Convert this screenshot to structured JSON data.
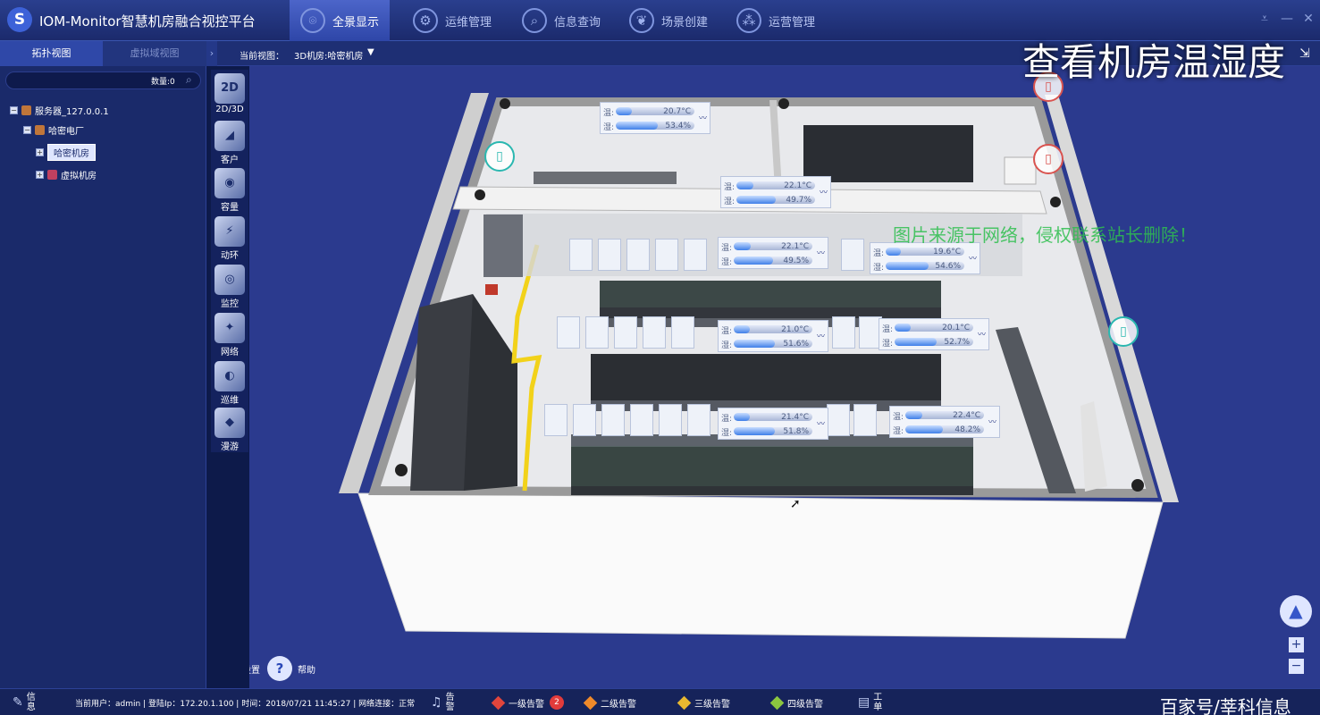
{
  "header": {
    "logo_glyph": "S",
    "title": "IOM-Monitor智慧机房融合视控平台",
    "nav": [
      {
        "label": "全景显示",
        "icon": "map-pin-icon",
        "active": true
      },
      {
        "label": "运维管理",
        "icon": "gear-icon",
        "active": false
      },
      {
        "label": "信息查询",
        "icon": "magnifier-icon",
        "active": false
      },
      {
        "label": "场景创建",
        "icon": "leaf-icon",
        "active": false
      },
      {
        "label": "运营管理",
        "icon": "network-icon",
        "active": false
      }
    ]
  },
  "overlay_title": "查看机房温湿度",
  "sidebar": {
    "tabs": [
      "拓扑视图",
      "虚拟域视图"
    ],
    "search_placeholder": "",
    "search_count": "数量:0",
    "tree": [
      {
        "label": "服务器_127.0.0.1",
        "toggle": "−"
      },
      {
        "label": "哈密电厂",
        "toggle": "−"
      },
      {
        "label": "哈密机房",
        "toggle": "+"
      },
      {
        "label": "虚拟机房",
        "toggle": "+"
      }
    ]
  },
  "viewbar": {
    "current_view_label": "当前视图：",
    "current_view_value": "3D机房:哈密机房"
  },
  "toolbar": [
    {
      "label": "2D/3D",
      "glyph": "2D"
    },
    {
      "label": "客户",
      "glyph": "◢"
    },
    {
      "label": "容量",
      "glyph": "◉"
    },
    {
      "label": "动环",
      "glyph": "⚡"
    },
    {
      "label": "监控",
      "glyph": "◎"
    },
    {
      "label": "网络",
      "glyph": "✦"
    },
    {
      "label": "巡维",
      "glyph": "◐"
    },
    {
      "label": "漫游",
      "glyph": "◆"
    }
  ],
  "scene": {
    "temp_label": "温:",
    "hum_label": "湿:",
    "sensors": [
      {
        "temp": "20.7°C",
        "hum": "53.4%",
        "temp_level": 0.2,
        "hum_level": 0.53
      },
      {
        "temp": "22.1°C",
        "hum": "49.7%",
        "temp_level": 0.22,
        "hum_level": 0.5
      },
      {
        "temp": "22.1°C",
        "hum": "49.5%",
        "temp_level": 0.22,
        "hum_level": 0.5
      },
      {
        "temp": "19.6°C",
        "hum": "54.6%",
        "temp_level": 0.19,
        "hum_level": 0.55
      },
      {
        "temp": "21.0°C",
        "hum": "51.6%",
        "temp_level": 0.21,
        "hum_level": 0.52
      },
      {
        "temp": "20.1°C",
        "hum": "52.7%",
        "temp_level": 0.2,
        "hum_level": 0.53
      },
      {
        "temp": "21.4°C",
        "hum": "51.8%",
        "temp_level": 0.21,
        "hum_level": 0.52
      },
      {
        "temp": "22.4°C",
        "hum": "48.2%",
        "temp_level": 0.22,
        "hum_level": 0.48
      }
    ],
    "watermark": "图片来源于网络，侵权联系站长删除！",
    "settings_label": "设置",
    "help_label": "帮助",
    "zoom_in": "+",
    "zoom_out": "−"
  },
  "statusbar": {
    "info_label": "信息",
    "status_text": "当前用户：admin | 登陆Ip：172.20.1.100 | 时间：2018/07/21 11:45:27 | 网络连接：正常",
    "alarm_label": "告警",
    "alarms": [
      {
        "label": "一级告警",
        "color": "#e2453c",
        "count": "2"
      },
      {
        "label": "二级告警",
        "color": "#f08a2a",
        "count": ""
      },
      {
        "label": "三级告警",
        "color": "#e8b830",
        "count": ""
      },
      {
        "label": "四级告警",
        "color": "#8cc63f",
        "count": ""
      }
    ],
    "workorder_label": "工单",
    "source": "百家号/莘科信息"
  },
  "colors": {
    "accent": "#3d62d8",
    "background": "#0d1a4a",
    "scene_bg": "#2b3a8e",
    "door_teal": "#2ab7b0",
    "door_red": "#d9534f"
  }
}
